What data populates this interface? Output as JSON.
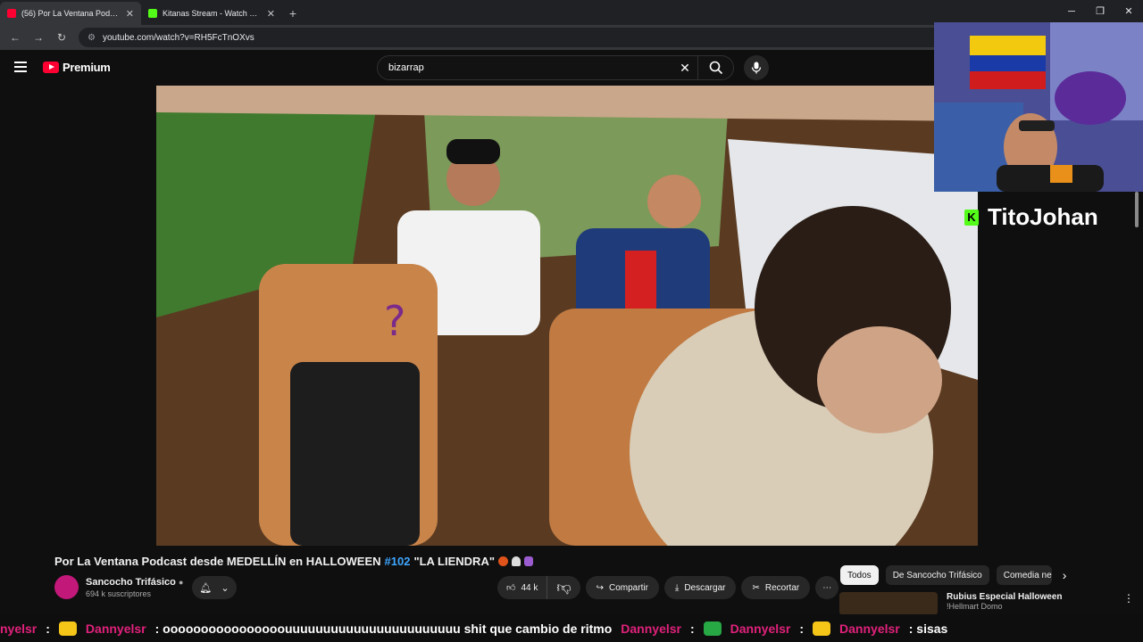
{
  "browser": {
    "tabs": [
      {
        "title": "(56) Por La Ventana Podcast de",
        "color": "#ff0033",
        "active": true
      },
      {
        "title": "Kitanas Stream - Watch Live on",
        "color": "#53fc18",
        "active": false
      }
    ],
    "url": "youtube.com/watch?v=RH5FcTnOXvs"
  },
  "youtube": {
    "logo_text": "Premium",
    "search_value": "bizarrap",
    "video_title": "Por La Ventana Podcast desde MEDELLÍN en HALLOWEEN",
    "video_tag": "#102",
    "video_title_end": "\"LA LIENDRA\"",
    "channel_name": "Sancocho Trifásico",
    "subscribers": "694 k suscriptores",
    "likes": "44 k",
    "share_label": "Compartir",
    "download_label": "Descargar",
    "clip_label": "Recortar",
    "chips": [
      "Todos",
      "De Sancocho Trifásico",
      "Comedia negra"
    ],
    "rec_title": "Rubius Especial Halloween",
    "rec_sub": "!Hellmart Domo"
  },
  "stream": {
    "streamer_name": "TitoJohan",
    "platform_icon": "K"
  },
  "chat_ticker": [
    {
      "user": "nyelsr",
      "msg": ""
    },
    {
      "user": "Dannyelsr",
      "msg": ": oooooooooooooooouuuuuuuuuuuuuuuuuuuuuuu shit que cambio de ritmo"
    },
    {
      "user": "Dannyelsr",
      "msg": ""
    },
    {
      "user": "Dannyelsr",
      "msg": ""
    },
    {
      "user": "Dannyelsr",
      "msg": ": sisas"
    }
  ]
}
